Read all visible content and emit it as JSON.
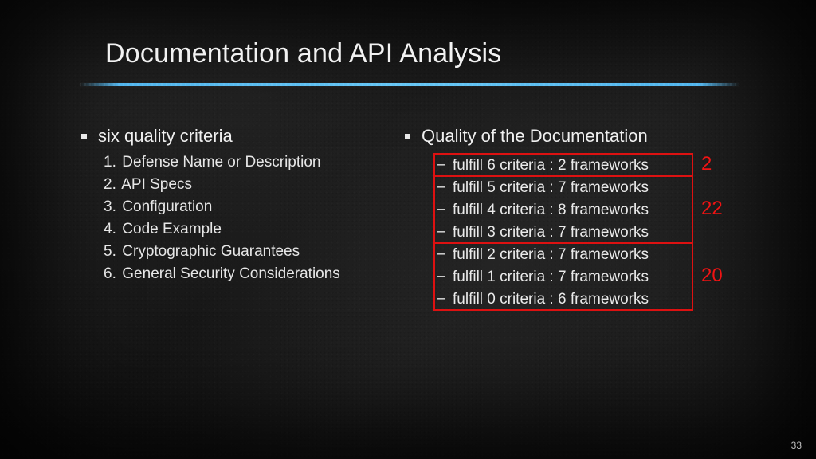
{
  "title": "Documentation and API Analysis",
  "left": {
    "heading": "six quality criteria",
    "items": [
      "Defense Name or Description",
      "API Specs",
      "Configuration",
      "Code Example",
      "Cryptographic Guarantees",
      "General Security Considerations"
    ]
  },
  "right": {
    "heading": "Quality of the Documentation",
    "items": [
      "fulfill 6 criteria : 2 frameworks",
      "fulfill 5 criteria : 7 frameworks",
      "fulfill 4 criteria : 8 frameworks",
      "fulfill 3 criteria : 7 frameworks",
      "fulfill 2 criteria : 7 frameworks",
      "fulfill 1 criteria : 7 frameworks",
      "fulfill 0 criteria : 6 frameworks"
    ],
    "groups": [
      {
        "rows": 1,
        "label": "2"
      },
      {
        "rows": 3,
        "label": "22"
      },
      {
        "rows": 3,
        "label": "20"
      }
    ]
  },
  "page_number": "33",
  "colors": {
    "accent_rule": "#5fb9e8",
    "alert": "#e01212"
  }
}
